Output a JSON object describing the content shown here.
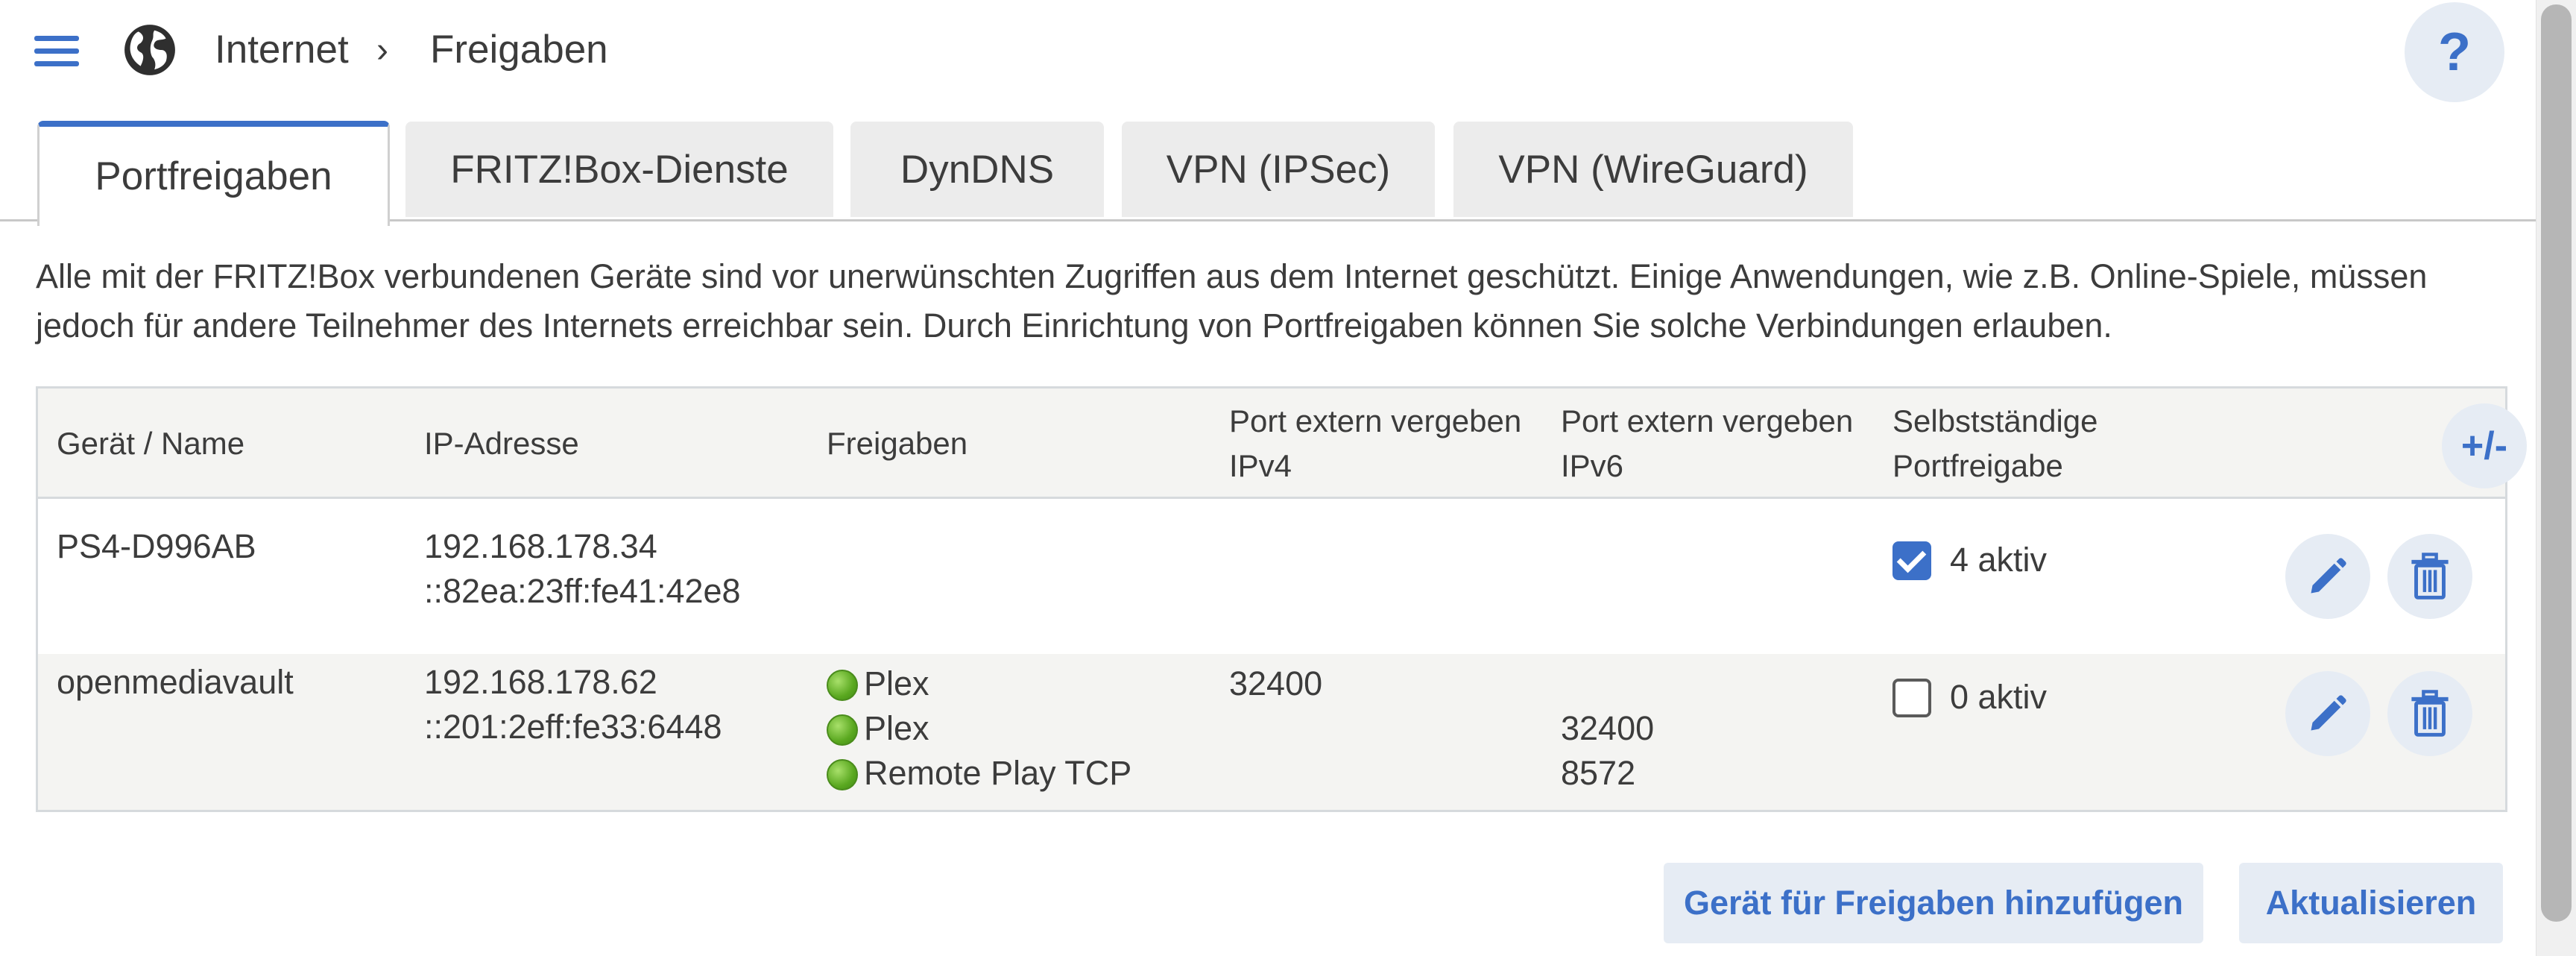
{
  "header": {
    "breadcrumb": [
      "Internet",
      "Freigaben"
    ],
    "help_label": "?"
  },
  "tabs": [
    {
      "label": "Portfreigaben",
      "active": true
    },
    {
      "label": "FRITZ!Box-Dienste",
      "active": false
    },
    {
      "label": "DynDNS",
      "active": false
    },
    {
      "label": "VPN (IPSec)",
      "active": false
    },
    {
      "label": "VPN (WireGuard)",
      "active": false
    }
  ],
  "intro": {
    "line1": "Alle mit der FRITZ!Box verbundenen Geräte sind vor unerwünschten Zugriffen aus dem Internet geschützt. Einige Anwendungen, wie z.B. Online-Spiele, müssen",
    "line2": "jedoch für andere Teilnehmer des Internets erreichbar sein. Durch Einrichtung von Portfreigaben können Sie solche Verbindungen erlauben."
  },
  "table": {
    "headers": {
      "device": "Gerät / Name",
      "ip": "IP-Adresse",
      "shares": "Freigaben",
      "port_v4_1": "Port extern vergeben",
      "port_v4_2": "IPv4",
      "port_v6_1": "Port extern vergeben",
      "port_v6_2": "IPv6",
      "self_1": "Selbstständige",
      "self_2": "Portfreigabe",
      "toggle_label": "+/-"
    },
    "rows": [
      {
        "device": "PS4-D996AB",
        "ipv4": "192.168.178.34",
        "ipv6": "::82ea:23ff:fe41:42e8",
        "shares": [],
        "self_enabled": true,
        "self_label": "4 aktiv"
      },
      {
        "device": "openmediavault",
        "ipv4": "192.168.178.62",
        "ipv6": "::201:2eff:fe33:6448",
        "shares": [
          "Plex",
          "Plex",
          "Remote Play TCP"
        ],
        "port_v4": "32400",
        "port_v6": [
          "32400",
          "8572"
        ],
        "self_enabled": false,
        "self_label": "0 aktiv"
      }
    ]
  },
  "buttons": {
    "add_device": "Gerät für Freigaben hinzufügen",
    "refresh": "Aktualisieren"
  },
  "colors": {
    "accent": "#3c70c8",
    "button_bg": "#e6ecf4",
    "status_ok": "#5aa820"
  }
}
